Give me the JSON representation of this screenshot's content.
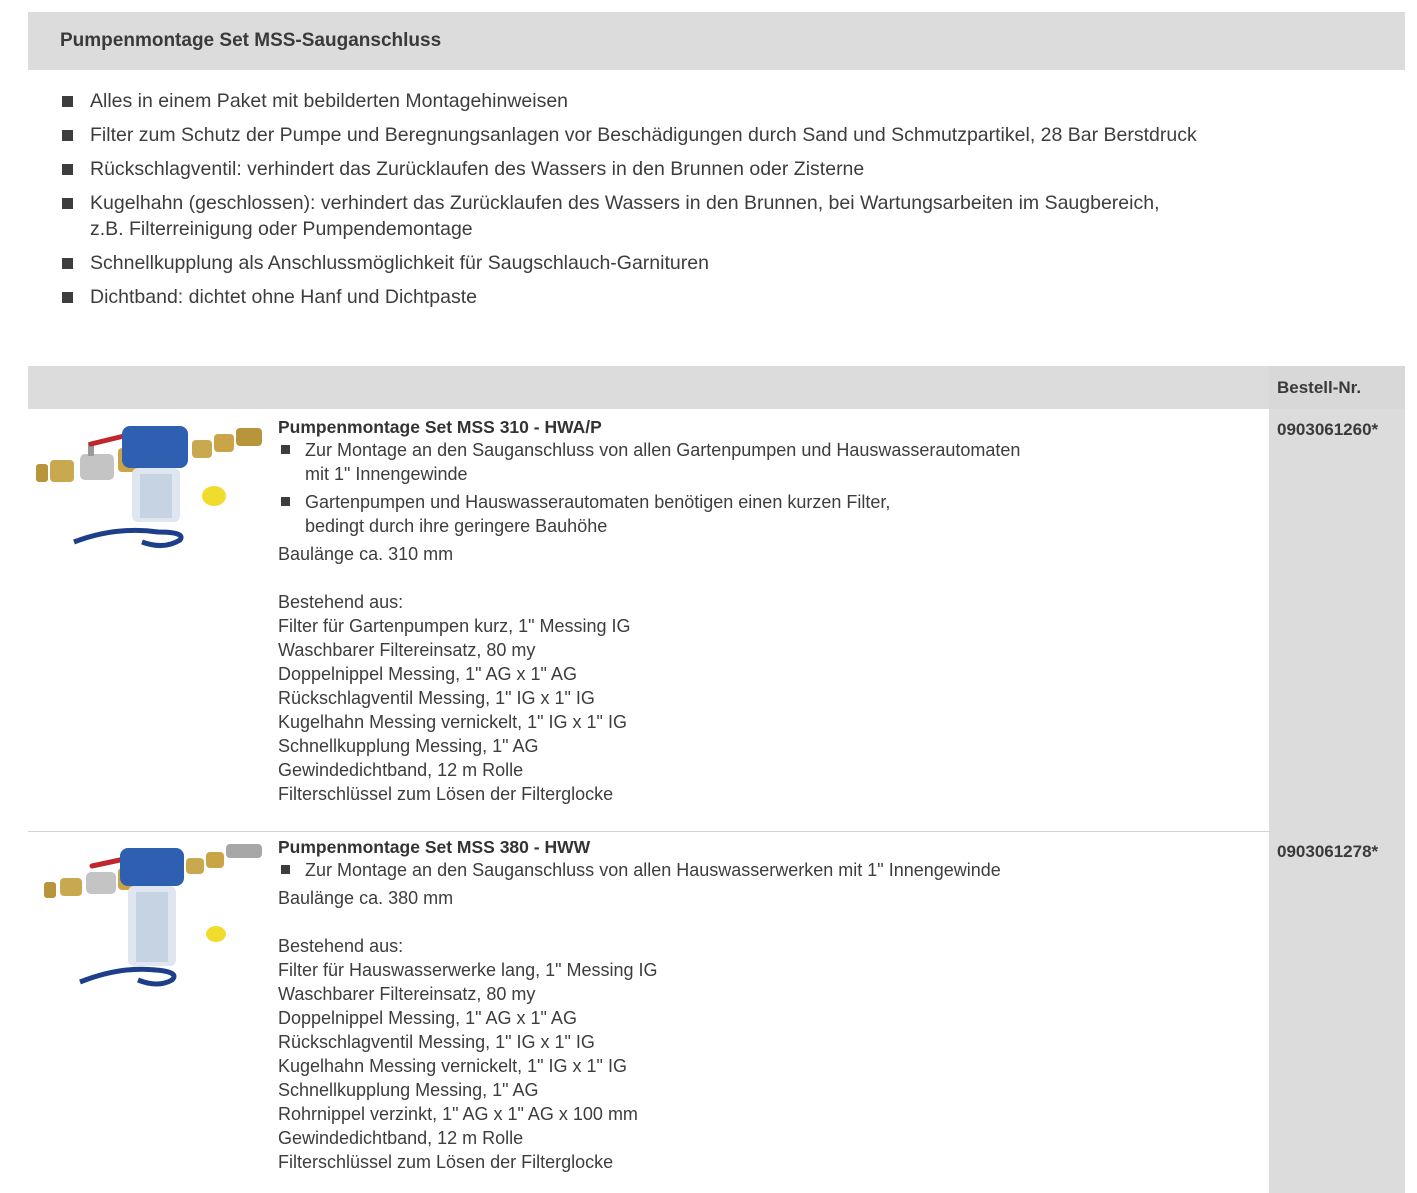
{
  "header": {
    "title": "Pumpenmontage Set MSS-Sauganschluss"
  },
  "features": [
    "Alles in einem Paket mit bebilderten Montagehinweisen",
    "Filter zum Schutz der Pumpe und Beregnungsanlagen vor Beschädigungen durch Sand und Schmutzpartikel, 28 Bar Berstdruck",
    "Rückschlagventil: verhindert das Zurücklaufen des Wassers in den Brunnen oder Zisterne",
    "Kugelhahn (geschlossen): verhindert das Zurücklaufen des Wassers in den Brunnen, bei Wartungsarbeiten im Saugbereich,",
    "z.B. Filterreinigung oder Pumpendemontage",
    "Schnellkupplung als Anschlussmöglichkeit für Saugschlauch-Garnituren",
    "Dichtband: dichtet ohne Hanf und Dichtpaste"
  ],
  "table": {
    "order_header": "Bestell-Nr."
  },
  "products": [
    {
      "name": "Pumpenmontage Set MSS 310 - HWA/P",
      "bullets": [
        [
          "Zur Montage an den Sauganschluss von allen Gartenpumpen und Hauswasserautomaten",
          "mit 1\" Innengewinde"
        ],
        [
          "Gartenpumpen und Hauswasserautomaten benötigen einen kurzen Filter,",
          "bedingt durch ihre geringere Bauhöhe"
        ]
      ],
      "length": "Baulänge ca. 310 mm",
      "consists_label": "Bestehend aus:",
      "components": [
        "Filter für Gartenpumpen kurz, 1\" Messing IG",
        "Waschbarer Filtereinsatz, 80 my",
        "Doppelnippel Messing, 1\" AG x 1\" AG",
        "Rückschlagventil Messing, 1\" IG x 1\" IG",
        "Kugelhahn Messing vernickelt, 1\" IG x 1\" IG",
        "Schnellkupplung Messing, 1\" AG",
        "Gewindedichtband, 12 m Rolle",
        "Filterschlüssel zum Lösen der Filterglocke"
      ],
      "order_no": "0903061260*"
    },
    {
      "name": "Pumpenmontage Set MSS 380 - HWW",
      "bullets": [
        [
          "Zur Montage an den Sauganschluss von allen Hauswasserwerken mit 1\" Innengewinde"
        ]
      ],
      "length": "Baulänge ca. 380 mm",
      "consists_label": "Bestehend aus:",
      "components": [
        "Filter für Hauswasserwerke lang, 1\" Messing IG",
        "Waschbarer Filtereinsatz, 80 my",
        "Doppelnippel Messing, 1\" AG x 1\" AG",
        "Rückschlagventil Messing, 1\" IG x 1\" IG",
        "Kugelhahn Messing vernickelt, 1\" IG x 1\" IG",
        "Schnellkupplung Messing, 1\" AG",
        "Rohrnippel verzinkt, 1\" AG x 1\" AG x 100 mm",
        "Gewindedichtband, 12 m Rolle",
        "Filterschlüssel zum Lösen der Filterglocke"
      ],
      "order_no": "0903061278*"
    }
  ]
}
